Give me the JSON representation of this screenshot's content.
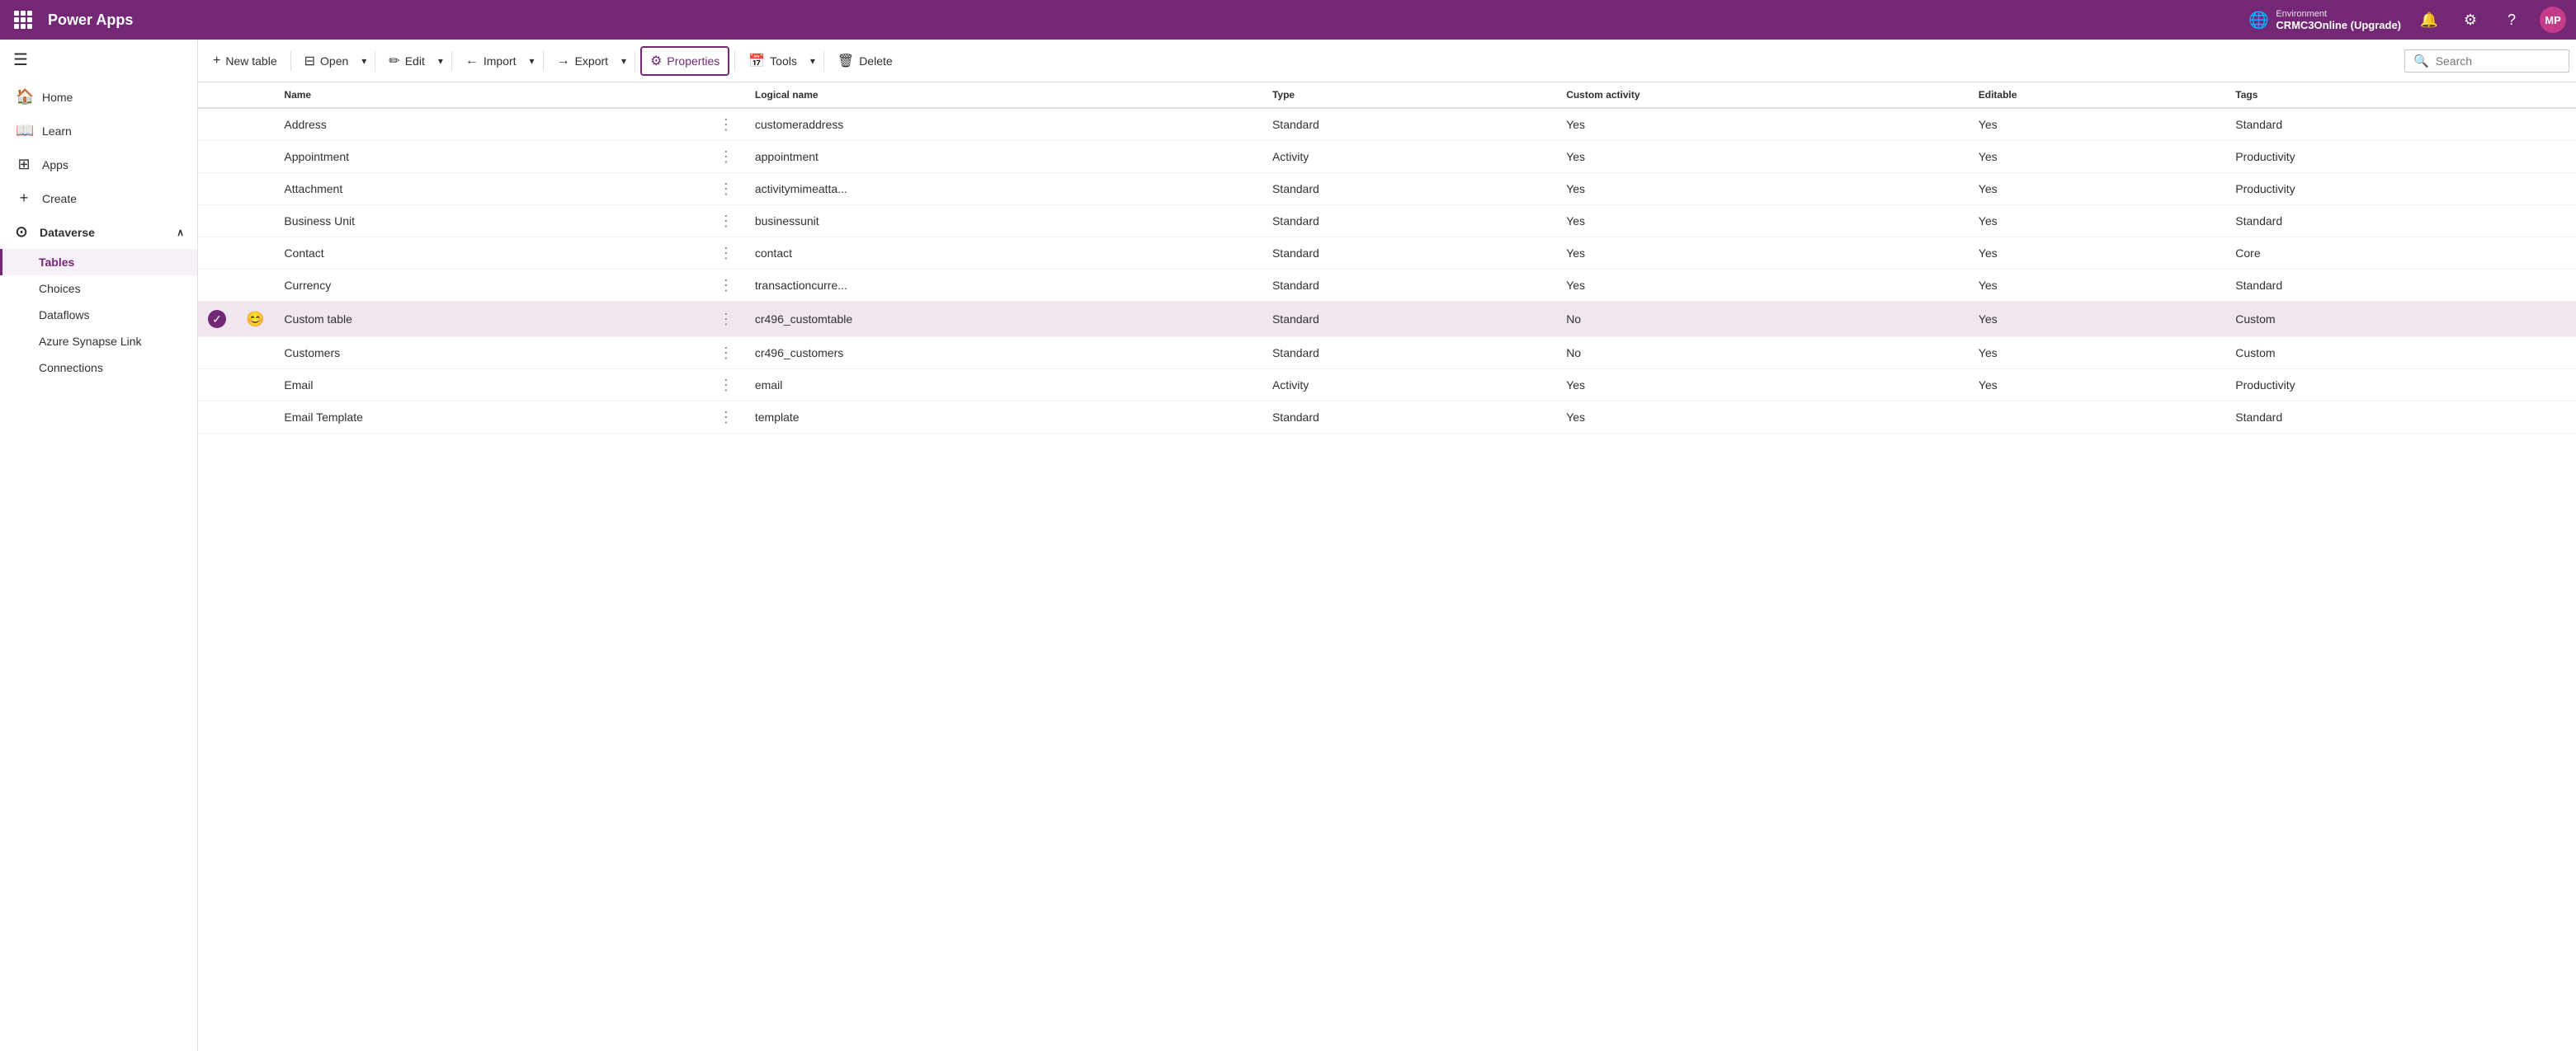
{
  "app": {
    "name": "Power Apps",
    "grid_icon": "apps-icon"
  },
  "environment": {
    "label": "Environment",
    "name": "CRMC3Online (Upgrade)"
  },
  "topbar": {
    "bell_label": "🔔",
    "settings_label": "⚙",
    "help_label": "?",
    "avatar_label": "MP"
  },
  "sidebar": {
    "menu_icon": "☰",
    "items": [
      {
        "id": "home",
        "label": "Home",
        "icon": "🏠"
      },
      {
        "id": "learn",
        "label": "Learn",
        "icon": "📖"
      },
      {
        "id": "apps",
        "label": "Apps",
        "icon": "⊞"
      },
      {
        "id": "create",
        "label": "Create",
        "icon": "+"
      }
    ],
    "dataverse_label": "Dataverse",
    "dataverse_icon": "⊙",
    "chevron": "∧",
    "sub_items": [
      {
        "id": "tables",
        "label": "Tables",
        "active": true
      },
      {
        "id": "choices",
        "label": "Choices"
      },
      {
        "id": "dataflows",
        "label": "Dataflows"
      },
      {
        "id": "azure-synapse",
        "label": "Azure Synapse Link"
      },
      {
        "id": "connections",
        "label": "Connections"
      }
    ]
  },
  "toolbar": {
    "new_table_label": "New table",
    "open_label": "Open",
    "edit_label": "Edit",
    "import_label": "Import",
    "export_label": "Export",
    "properties_label": "Properties",
    "tools_label": "Tools",
    "delete_label": "Delete",
    "search_placeholder": "Search",
    "new_icon": "+",
    "open_icon": "⊟",
    "edit_icon": "✏",
    "import_icon": "←",
    "export_icon": "→",
    "properties_icon": "⚙",
    "tools_icon": "📅",
    "delete_icon": "🗑"
  },
  "table": {
    "columns": [
      {
        "id": "name",
        "label": "Name"
      },
      {
        "id": "logical_name",
        "label": "Logical name"
      },
      {
        "id": "type",
        "label": "Type"
      },
      {
        "id": "custom_activity",
        "label": "Custom activity"
      },
      {
        "id": "editable",
        "label": "Editable"
      },
      {
        "id": "tags",
        "label": "Tags"
      }
    ],
    "rows": [
      {
        "name": "Address",
        "logical_name": "customeraddress",
        "type": "Standard",
        "custom_activity": "Yes",
        "editable": "Yes",
        "tags": "Standard",
        "selected": false
      },
      {
        "name": "Appointment",
        "logical_name": "appointment",
        "type": "Activity",
        "custom_activity": "Yes",
        "editable": "Yes",
        "tags": "Productivity",
        "selected": false
      },
      {
        "name": "Attachment",
        "logical_name": "activitymimeatta...",
        "type": "Standard",
        "custom_activity": "Yes",
        "editable": "Yes",
        "tags": "Productivity",
        "selected": false
      },
      {
        "name": "Business Unit",
        "logical_name": "businessunit",
        "type": "Standard",
        "custom_activity": "Yes",
        "editable": "Yes",
        "tags": "Standard",
        "selected": false
      },
      {
        "name": "Contact",
        "logical_name": "contact",
        "type": "Standard",
        "custom_activity": "Yes",
        "editable": "Yes",
        "tags": "Core",
        "selected": false
      },
      {
        "name": "Currency",
        "logical_name": "transactioncurre...",
        "type": "Standard",
        "custom_activity": "Yes",
        "editable": "Yes",
        "tags": "Standard",
        "selected": false
      },
      {
        "name": "Custom table",
        "logical_name": "cr496_customtable",
        "type": "Standard",
        "custom_activity": "No",
        "editable": "Yes",
        "tags": "Custom",
        "selected": true,
        "has_check": true,
        "has_emoji": true
      },
      {
        "name": "Customers",
        "logical_name": "cr496_customers",
        "type": "Standard",
        "custom_activity": "No",
        "editable": "Yes",
        "tags": "Custom",
        "selected": false
      },
      {
        "name": "Email",
        "logical_name": "email",
        "type": "Activity",
        "custom_activity": "Yes",
        "editable": "Yes",
        "tags": "Productivity",
        "selected": false
      },
      {
        "name": "Email Template",
        "logical_name": "template",
        "type": "Standard",
        "custom_activity": "Yes",
        "editable": "",
        "tags": "Standard",
        "selected": false
      }
    ]
  }
}
